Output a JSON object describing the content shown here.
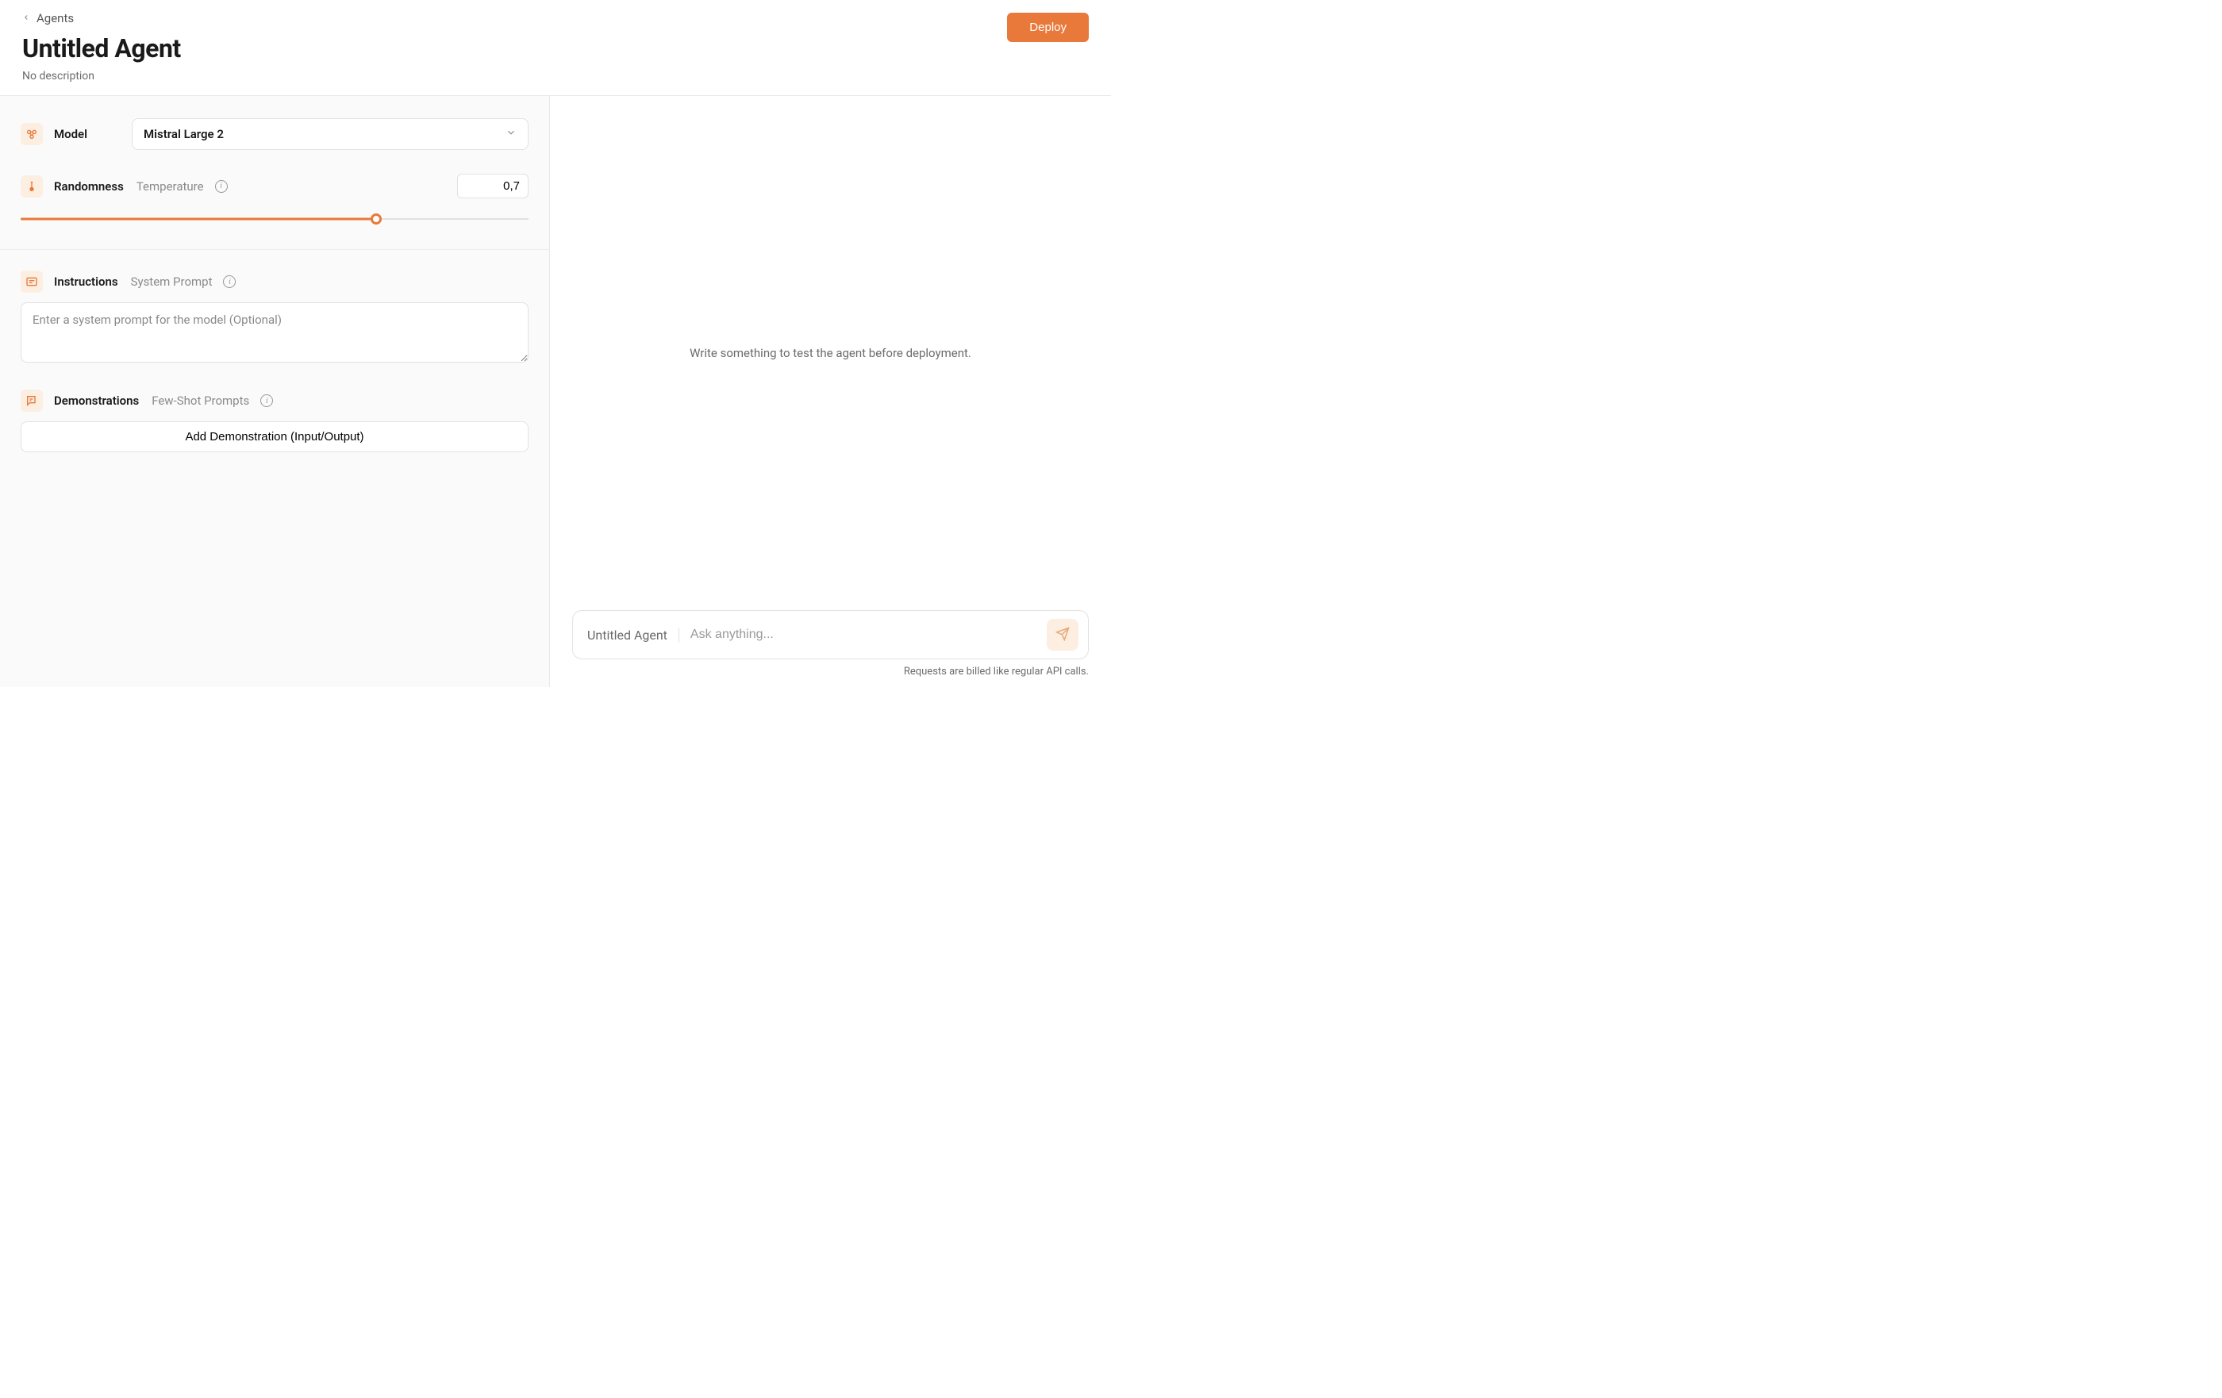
{
  "breadcrumb": {
    "label": "Agents"
  },
  "header": {
    "title": "Untitled Agent",
    "subtitle": "No description",
    "deploy_label": "Deploy"
  },
  "config": {
    "model": {
      "label": "Model",
      "selected": "Mistral Large 2"
    },
    "randomness": {
      "label": "Randomness",
      "sub_label": "Temperature",
      "value": "0,7",
      "fraction": 0.7
    },
    "instructions": {
      "label": "Instructions",
      "sub_label": "System Prompt",
      "placeholder": "Enter a system prompt for the model (Optional)"
    },
    "demonstrations": {
      "label": "Demonstrations",
      "sub_label": "Few-Shot Prompts",
      "add_button": "Add Demonstration (Input/Output)"
    }
  },
  "playground": {
    "placeholder_text": "Write something to test the agent before deployment.",
    "agent_name": "Untitled Agent",
    "input_placeholder": "Ask anything...",
    "billing_note": "Requests are billed like regular API calls."
  },
  "colors": {
    "accent": "#e8793a",
    "accent_light": "#fdeee2"
  }
}
